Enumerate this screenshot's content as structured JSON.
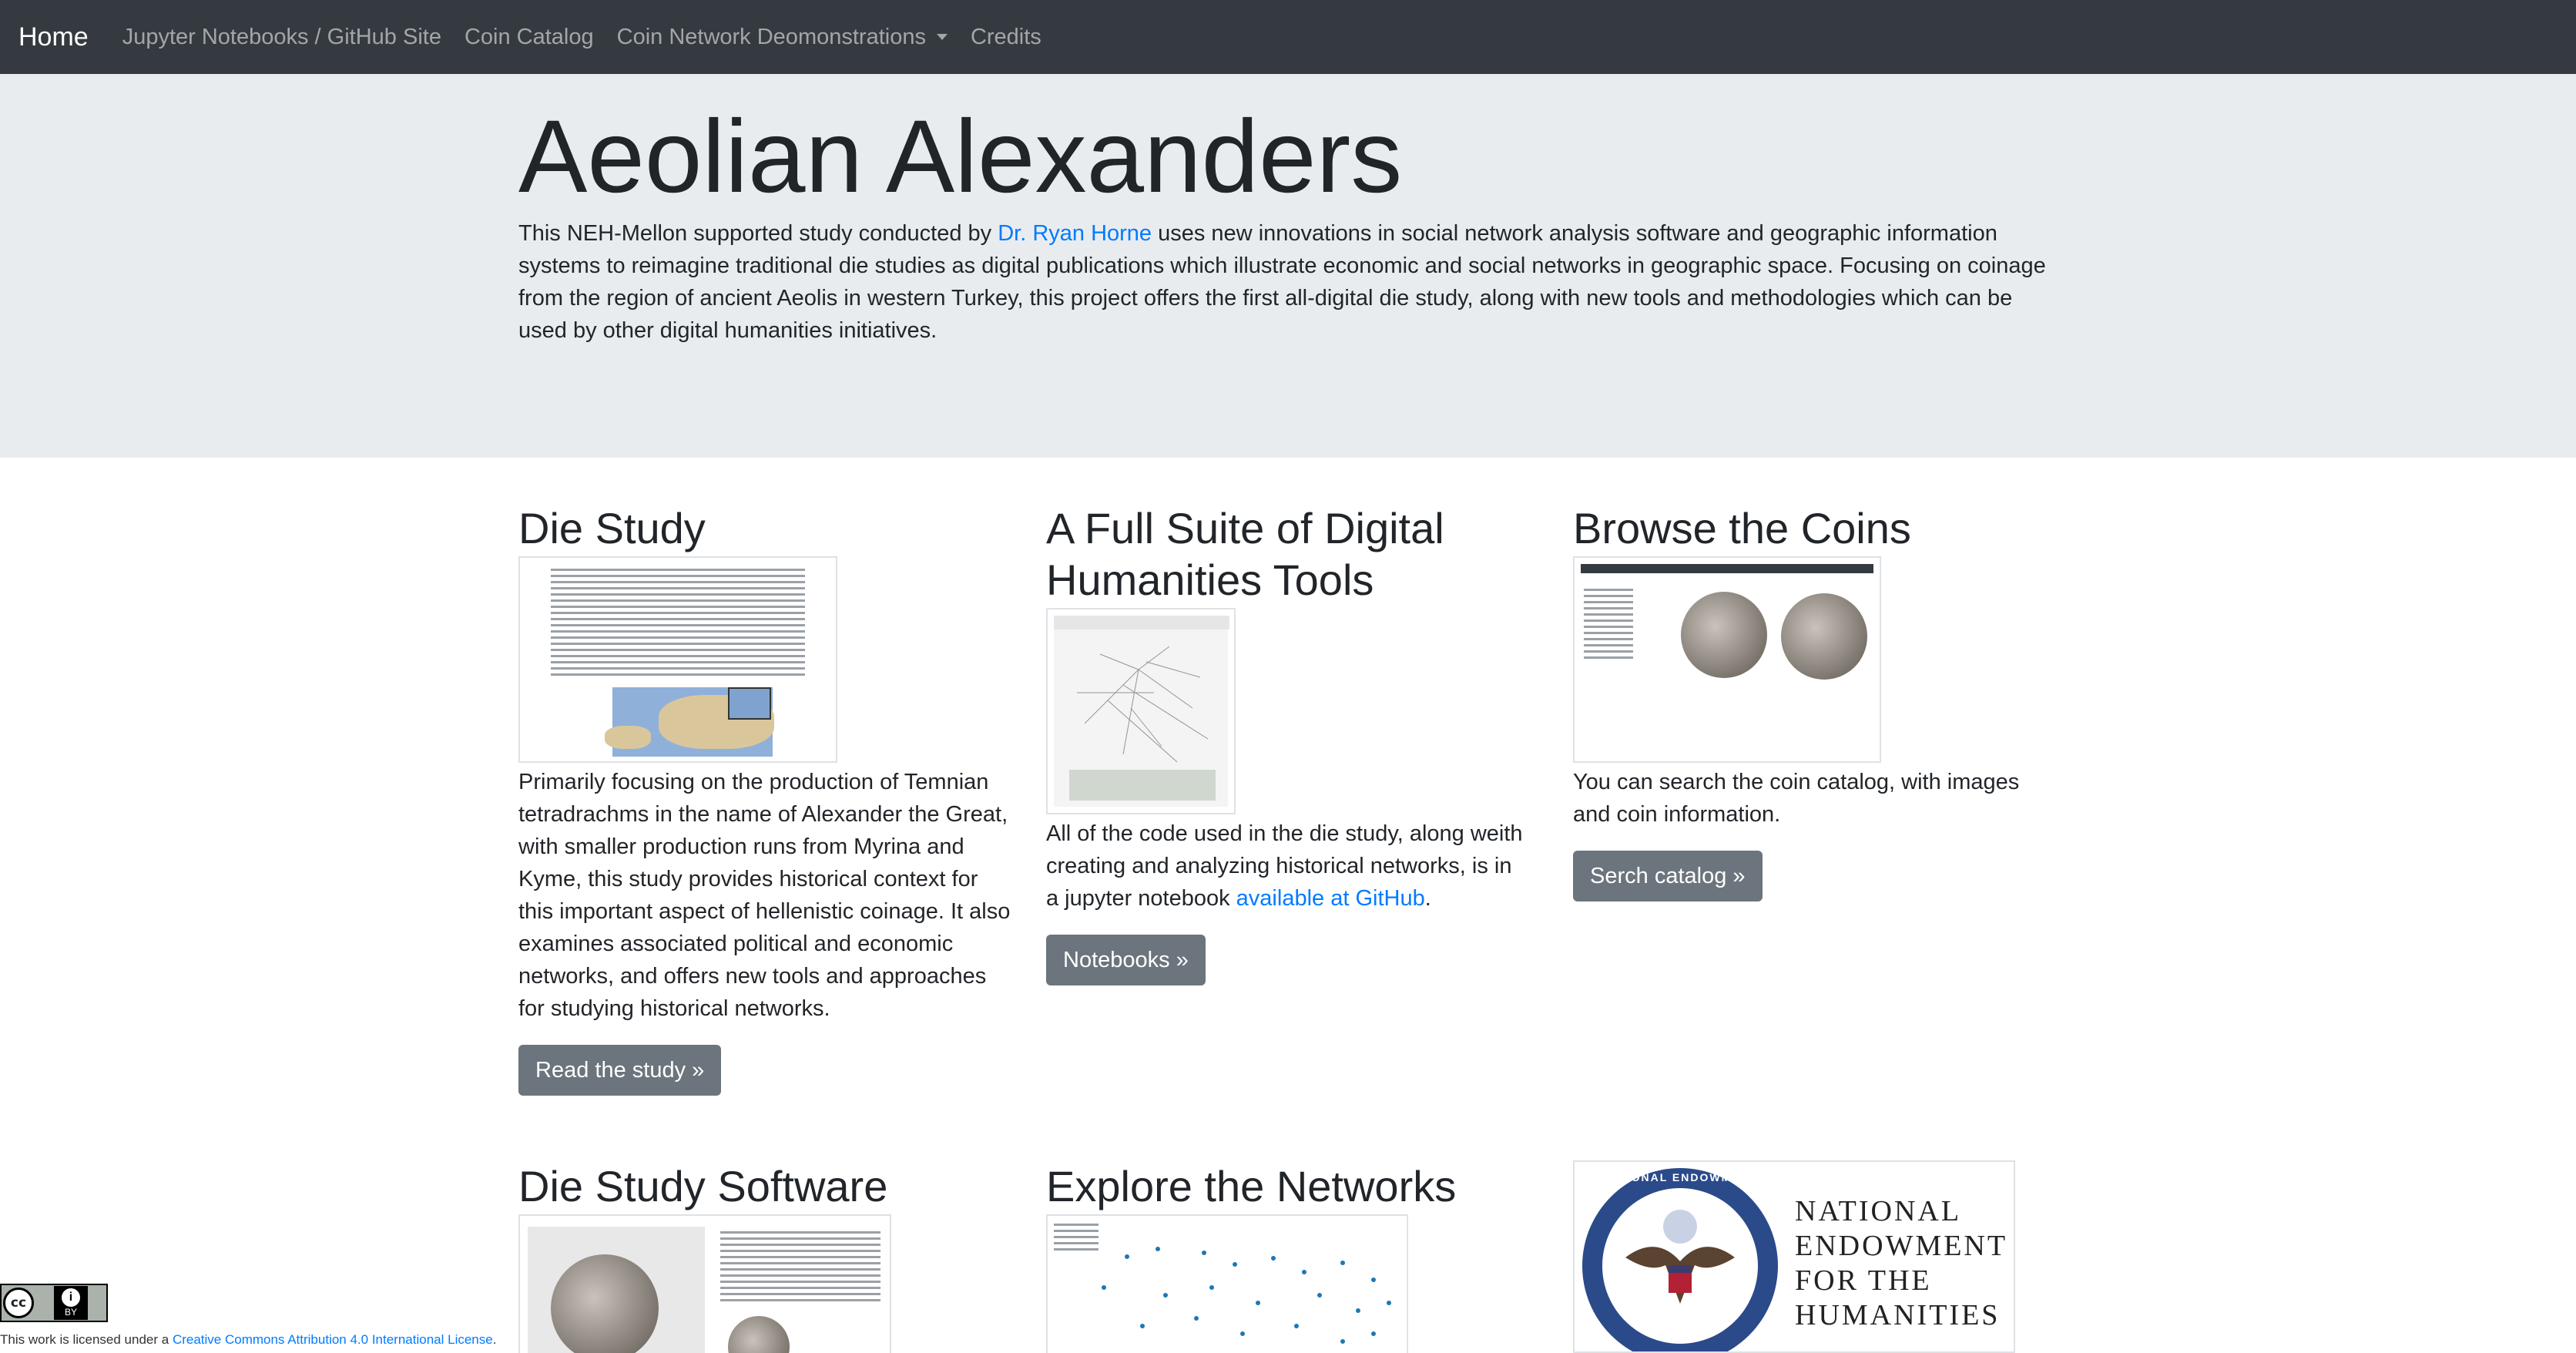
{
  "nav": {
    "brand": "Home",
    "links": [
      {
        "label": "Jupyter Notebooks / GitHub Site"
      },
      {
        "label": "Coin Catalog"
      },
      {
        "label": "Coin Network Deomonstrations",
        "dropdown": true
      },
      {
        "label": "Credits"
      }
    ]
  },
  "hero": {
    "title": "Aeolian Alexanders",
    "text_before": "This NEH-Mellon supported study conducted by ",
    "link": "Dr. Ryan Horne",
    "text_after": " uses new innovations in social network analysis software and geographic information systems to reimagine traditional die studies as digital publications which illustrate economic and social networks in geographic space. Focusing on coinage from the region of ancient Aeolis in western Turkey, this project offers the first all-digital die study, along with new tools and methodologies which can be used by other digital humanities initiatives."
  },
  "cards": {
    "die_study": {
      "heading": "Die Study",
      "text": "Primarily focusing on the production of Temnian tetradrachms in the name of Alexander the Great, with smaller production runs from Myrina and Kyme, this study provides historical context for this important aspect of hellenistic coinage. It also examines associated political and economic networks, and offers new tools and approaches for studying historical networks.",
      "button": "Read the study »"
    },
    "tools": {
      "heading": "A Full Suite of Digital Humanities Tools",
      "text_before": "All of the code used in the die study, along weith creating and analyzing historical networks, is in a jupyter notebook ",
      "link": "available at GitHub",
      "text_after": ".",
      "button": "Notebooks »"
    },
    "browse": {
      "heading": "Browse the Coins",
      "text": "You can search the coin catalog, with images and coin information.",
      "button": "Serch catalog »"
    },
    "software": {
      "heading": "Die Study Software"
    },
    "networks": {
      "heading": "Explore the Networks"
    }
  },
  "neh_logo": {
    "seal_text": "NATIONAL ENDOWMENT",
    "lines": [
      "NATIONAL",
      "ENDOWMENT",
      "FOR THE",
      "HUMANITIES"
    ]
  },
  "footer": {
    "cc_badge": "cc",
    "by_label": "BY",
    "license_before": "This work is licensed under a ",
    "license_link": "Creative Commons Attribution 4.0 International License",
    "license_after": "."
  },
  "colors": {
    "navbar": "#343a40",
    "jumbotron": "#e9ecef",
    "link": "#007bff",
    "button": "#6c757d"
  }
}
